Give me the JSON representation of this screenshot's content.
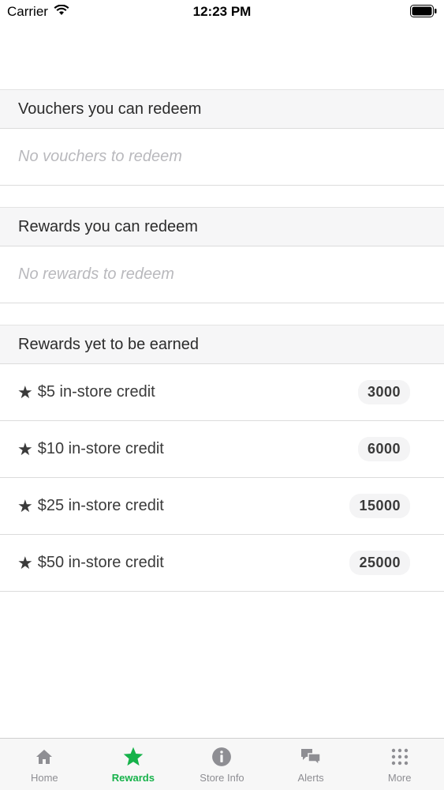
{
  "status_bar": {
    "carrier": "Carrier",
    "time": "12:23 PM"
  },
  "sections": {
    "vouchers": {
      "title": "Vouchers you can redeem",
      "empty_text": "No vouchers to redeem"
    },
    "rewards": {
      "title": "Rewards you can redeem",
      "empty_text": "No rewards to redeem"
    },
    "earn": {
      "title": "Rewards yet to be earned",
      "star": "★",
      "items": [
        {
          "label": "$5 in-store credit",
          "points": "3000"
        },
        {
          "label": "$10 in-store credit",
          "points": "6000"
        },
        {
          "label": "$25 in-store credit",
          "points": "15000"
        },
        {
          "label": "$50 in-store credit",
          "points": "25000"
        }
      ]
    }
  },
  "tabs": [
    {
      "label": "Home",
      "icon": "home-icon"
    },
    {
      "label": "Rewards",
      "icon": "star-icon"
    },
    {
      "label": "Store Info",
      "icon": "info-icon"
    },
    {
      "label": "Alerts",
      "icon": "chat-bubbles-icon"
    },
    {
      "label": "More",
      "icon": "grid-dots-icon"
    }
  ],
  "colors": {
    "accent": "#16b24a",
    "inactive_tab": "#8e8e93",
    "section_bg": "#f6f6f7"
  }
}
